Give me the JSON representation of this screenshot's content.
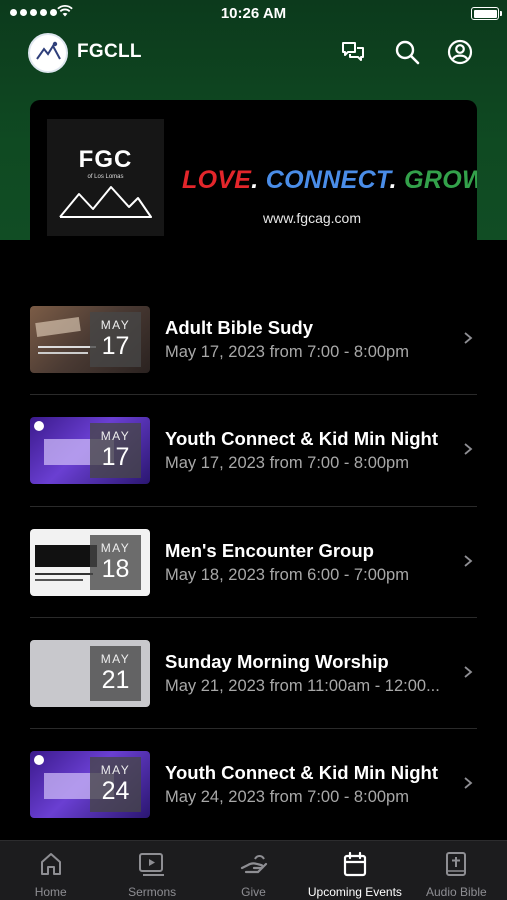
{
  "status_bar": {
    "time": "10:26 AM"
  },
  "header": {
    "title": "FGCLL",
    "icons": [
      "chat-icon",
      "search-icon",
      "profile-icon"
    ]
  },
  "banner": {
    "logo_text": "FGC",
    "logo_subtext": "of Los Lomas",
    "tagline": {
      "love": "LOVE",
      "connect": "CONNECT",
      "grow": "GROW",
      "dot": "."
    },
    "website": "www.fgcag.com",
    "colors": {
      "love": "#e3262b",
      "connect": "#4a8de8",
      "grow": "#33a14a"
    }
  },
  "events": [
    {
      "title": "Adult Bible Sudy",
      "time": "May 17, 2023 from 7:00 - 8:00pm",
      "month": "MAY",
      "day": "17"
    },
    {
      "title": "Youth Connect & Kid Min Night",
      "time": "May 17, 2023 from 7:00 - 8:00pm",
      "month": "MAY",
      "day": "17"
    },
    {
      "title": "Men's Encounter Group",
      "time": "May 18, 2023 from 6:00 - 7:00pm",
      "month": "MAY",
      "day": "18"
    },
    {
      "title": "Sunday Morning Worship",
      "time": "May 21, 2023 from 11:00am - 12:00...",
      "month": "MAY",
      "day": "21"
    },
    {
      "title": "Youth Connect & Kid Min Night",
      "time": "May 24, 2023 from 7:00 - 8:00pm",
      "month": "MAY",
      "day": "24"
    }
  ],
  "tabs": [
    {
      "label": "Home",
      "icon": "home-icon",
      "active": false
    },
    {
      "label": "Sermons",
      "icon": "video-icon",
      "active": false
    },
    {
      "label": "Give",
      "icon": "give-icon",
      "active": false
    },
    {
      "label": "Upcoming Events",
      "icon": "calendar-icon",
      "active": true
    },
    {
      "label": "Audio Bible",
      "icon": "bible-icon",
      "active": false
    }
  ]
}
